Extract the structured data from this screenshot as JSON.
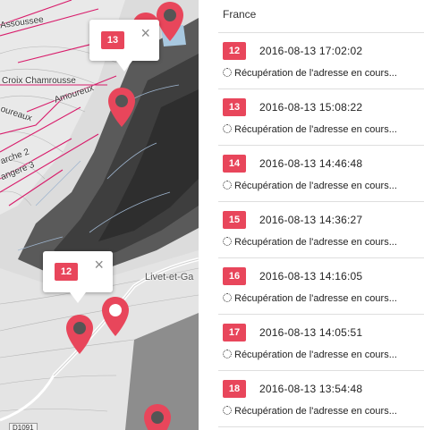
{
  "map": {
    "labels": {
      "assoussee": "Assoussee",
      "croix": "Croix Chamrousse",
      "amoureux": "Amoureux",
      "oureaux": "oureaux",
      "arche": "arche 2",
      "angere": "angere 3",
      "livet": "Livet-et-Ga",
      "road": "D1091"
    },
    "popups": [
      {
        "badge": "13",
        "close": "×"
      },
      {
        "badge": "12",
        "close": "×"
      }
    ],
    "marker_color": "#e8465b"
  },
  "list": {
    "location_header": "France",
    "entries": [
      {
        "badge": "12",
        "datetime": "2016-08-13 17:02:02",
        "status": "Récupération de l'adresse en cours..."
      },
      {
        "badge": "13",
        "datetime": "2016-08-13 15:08:22",
        "status": "Récupération de l'adresse en cours..."
      },
      {
        "badge": "14",
        "datetime": "2016-08-13 14:46:48",
        "status": "Récupération de l'adresse en cours..."
      },
      {
        "badge": "15",
        "datetime": "2016-08-13 14:36:27",
        "status": "Récupération de l'adresse en cours..."
      },
      {
        "badge": "16",
        "datetime": "2016-08-13 14:16:05",
        "status": "Récupération de l'adresse en cours..."
      },
      {
        "badge": "17",
        "datetime": "2016-08-13 14:05:51",
        "status": "Récupération de l'adresse en cours..."
      },
      {
        "badge": "18",
        "datetime": "2016-08-13 13:54:48",
        "status": "Récupération de l'adresse en cours..."
      }
    ]
  }
}
